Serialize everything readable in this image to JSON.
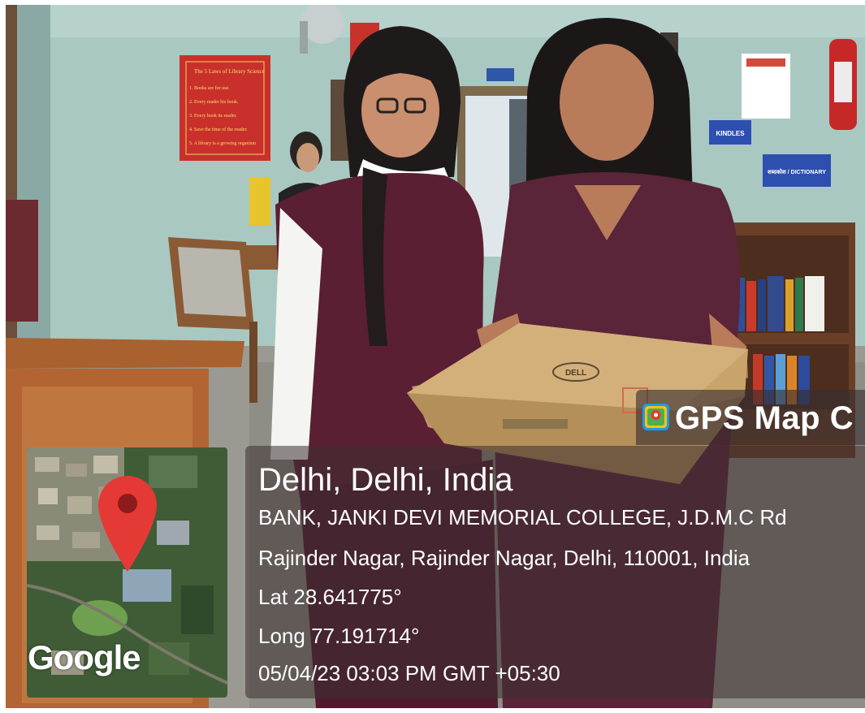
{
  "photo": {
    "subject": "two-women-holding-laptop-box",
    "colors": {
      "wall": "#a9c8c2",
      "dress": "#5a1f33",
      "box": "#c9a46a"
    }
  },
  "scene_text": {
    "poster_title": "The 5 Laws of Library Science",
    "poster_lines": [
      "1. Books are for use.",
      "2. Every reader his book.",
      "3. Every book its reader.",
      "4. Save the time of the reader.",
      "5. A library is a growing organism"
    ],
    "sign_kindles": "KINDLES",
    "sign_dictionary": "शब्दकोश / DICTIONARY",
    "box_brand": "DELL"
  },
  "gps": {
    "app_title": "GPS Map C",
    "app_icon": "gps-map-camera-icon",
    "city_line": "Delhi, Delhi, India",
    "address_line1": "BANK, JANKI DEVI MEMORIAL COLLEGE, J.D.M.C Rd",
    "address_line2": "Rajinder Nagar, Rajinder Nagar, Delhi, 110001, India",
    "latitude": "Lat 28.641775°",
    "longitude": "Long 77.191714°",
    "timestamp": "05/04/23 03:03 PM GMT +05:30"
  },
  "map": {
    "logo_text": "Google",
    "pin_icon": "map-pin-icon",
    "pin_color": "#e53935"
  }
}
